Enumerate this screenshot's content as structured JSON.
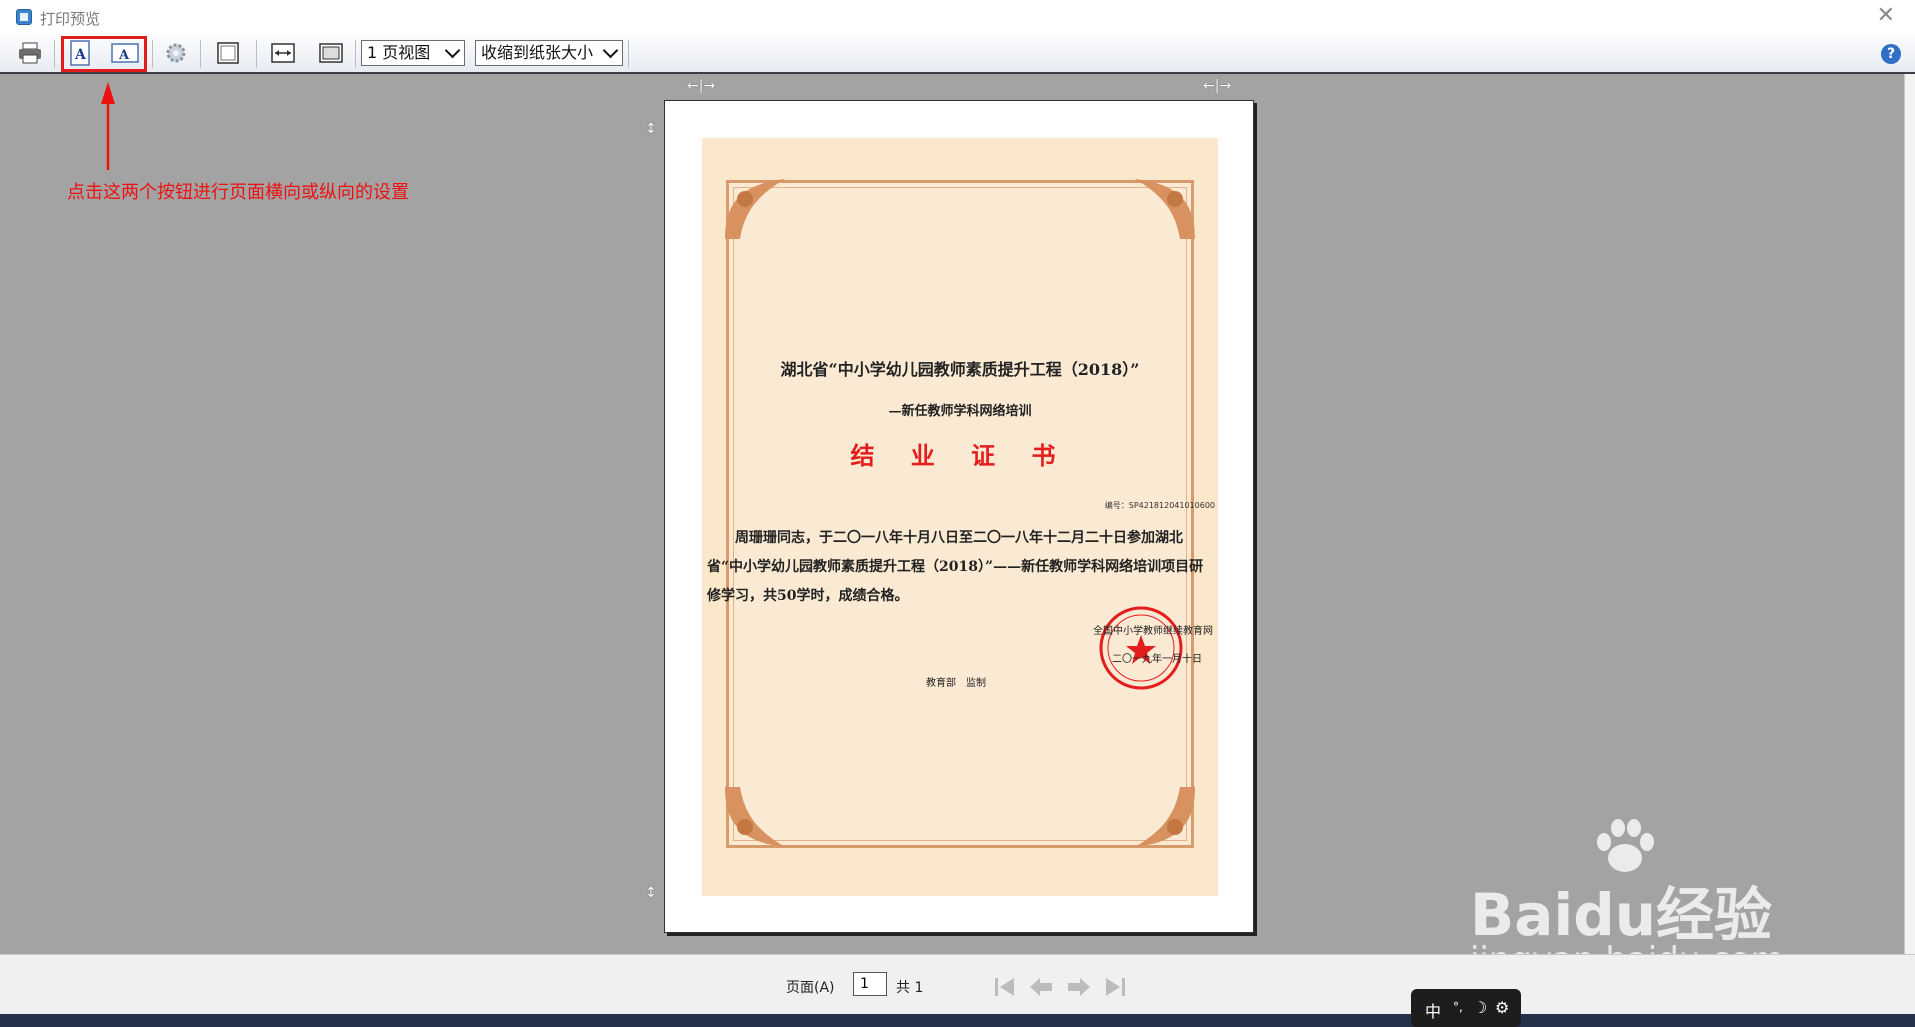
{
  "window": {
    "title": "打印预览",
    "close_icon": "close-icon"
  },
  "toolbar": {
    "icons": [
      "printer-icon",
      "portrait-icon",
      "landscape-icon",
      "settings-gear-icon",
      "page-view-icon",
      "fit-width-icon",
      "fit-page-icon",
      "help-icon"
    ],
    "view_select": "1 页视图",
    "zoom_select": "收缩到纸张大小",
    "help_label": "?"
  },
  "annotation": {
    "text": "点击这两个按钮进行页面横向或纵向的设置",
    "color": "#e11111"
  },
  "certificate": {
    "title1": "湖北省“中小学幼儿园教师素质提升工程（2018）”",
    "title2": "—新任教师学科网络培训",
    "title3": "结 业 证 书",
    "number": "编号：SP421812041010600",
    "body": "周珊珊同志，于二〇一八年十月八日至二〇一八年十二月二十日参加湖北省“中小学幼儿园教师素质提升工程（2018）”——新任教师学科网络培训项目研修学习，共50学时，成绩合格。",
    "issuer": "全国中小学教师继续教育网",
    "date": "二〇一九年一月十日",
    "supervisor": "教育部　监制",
    "seal_color": "#e41d1d"
  },
  "statusbar": {
    "page_label": "页面(A)",
    "page_value": "1",
    "total_label": "共  1"
  },
  "ime": {
    "lang": "中",
    "a": "°,",
    "b": "☽"
  },
  "watermark": {
    "brand": "Baidu经验",
    "url": "jingyan.baidu.com"
  }
}
